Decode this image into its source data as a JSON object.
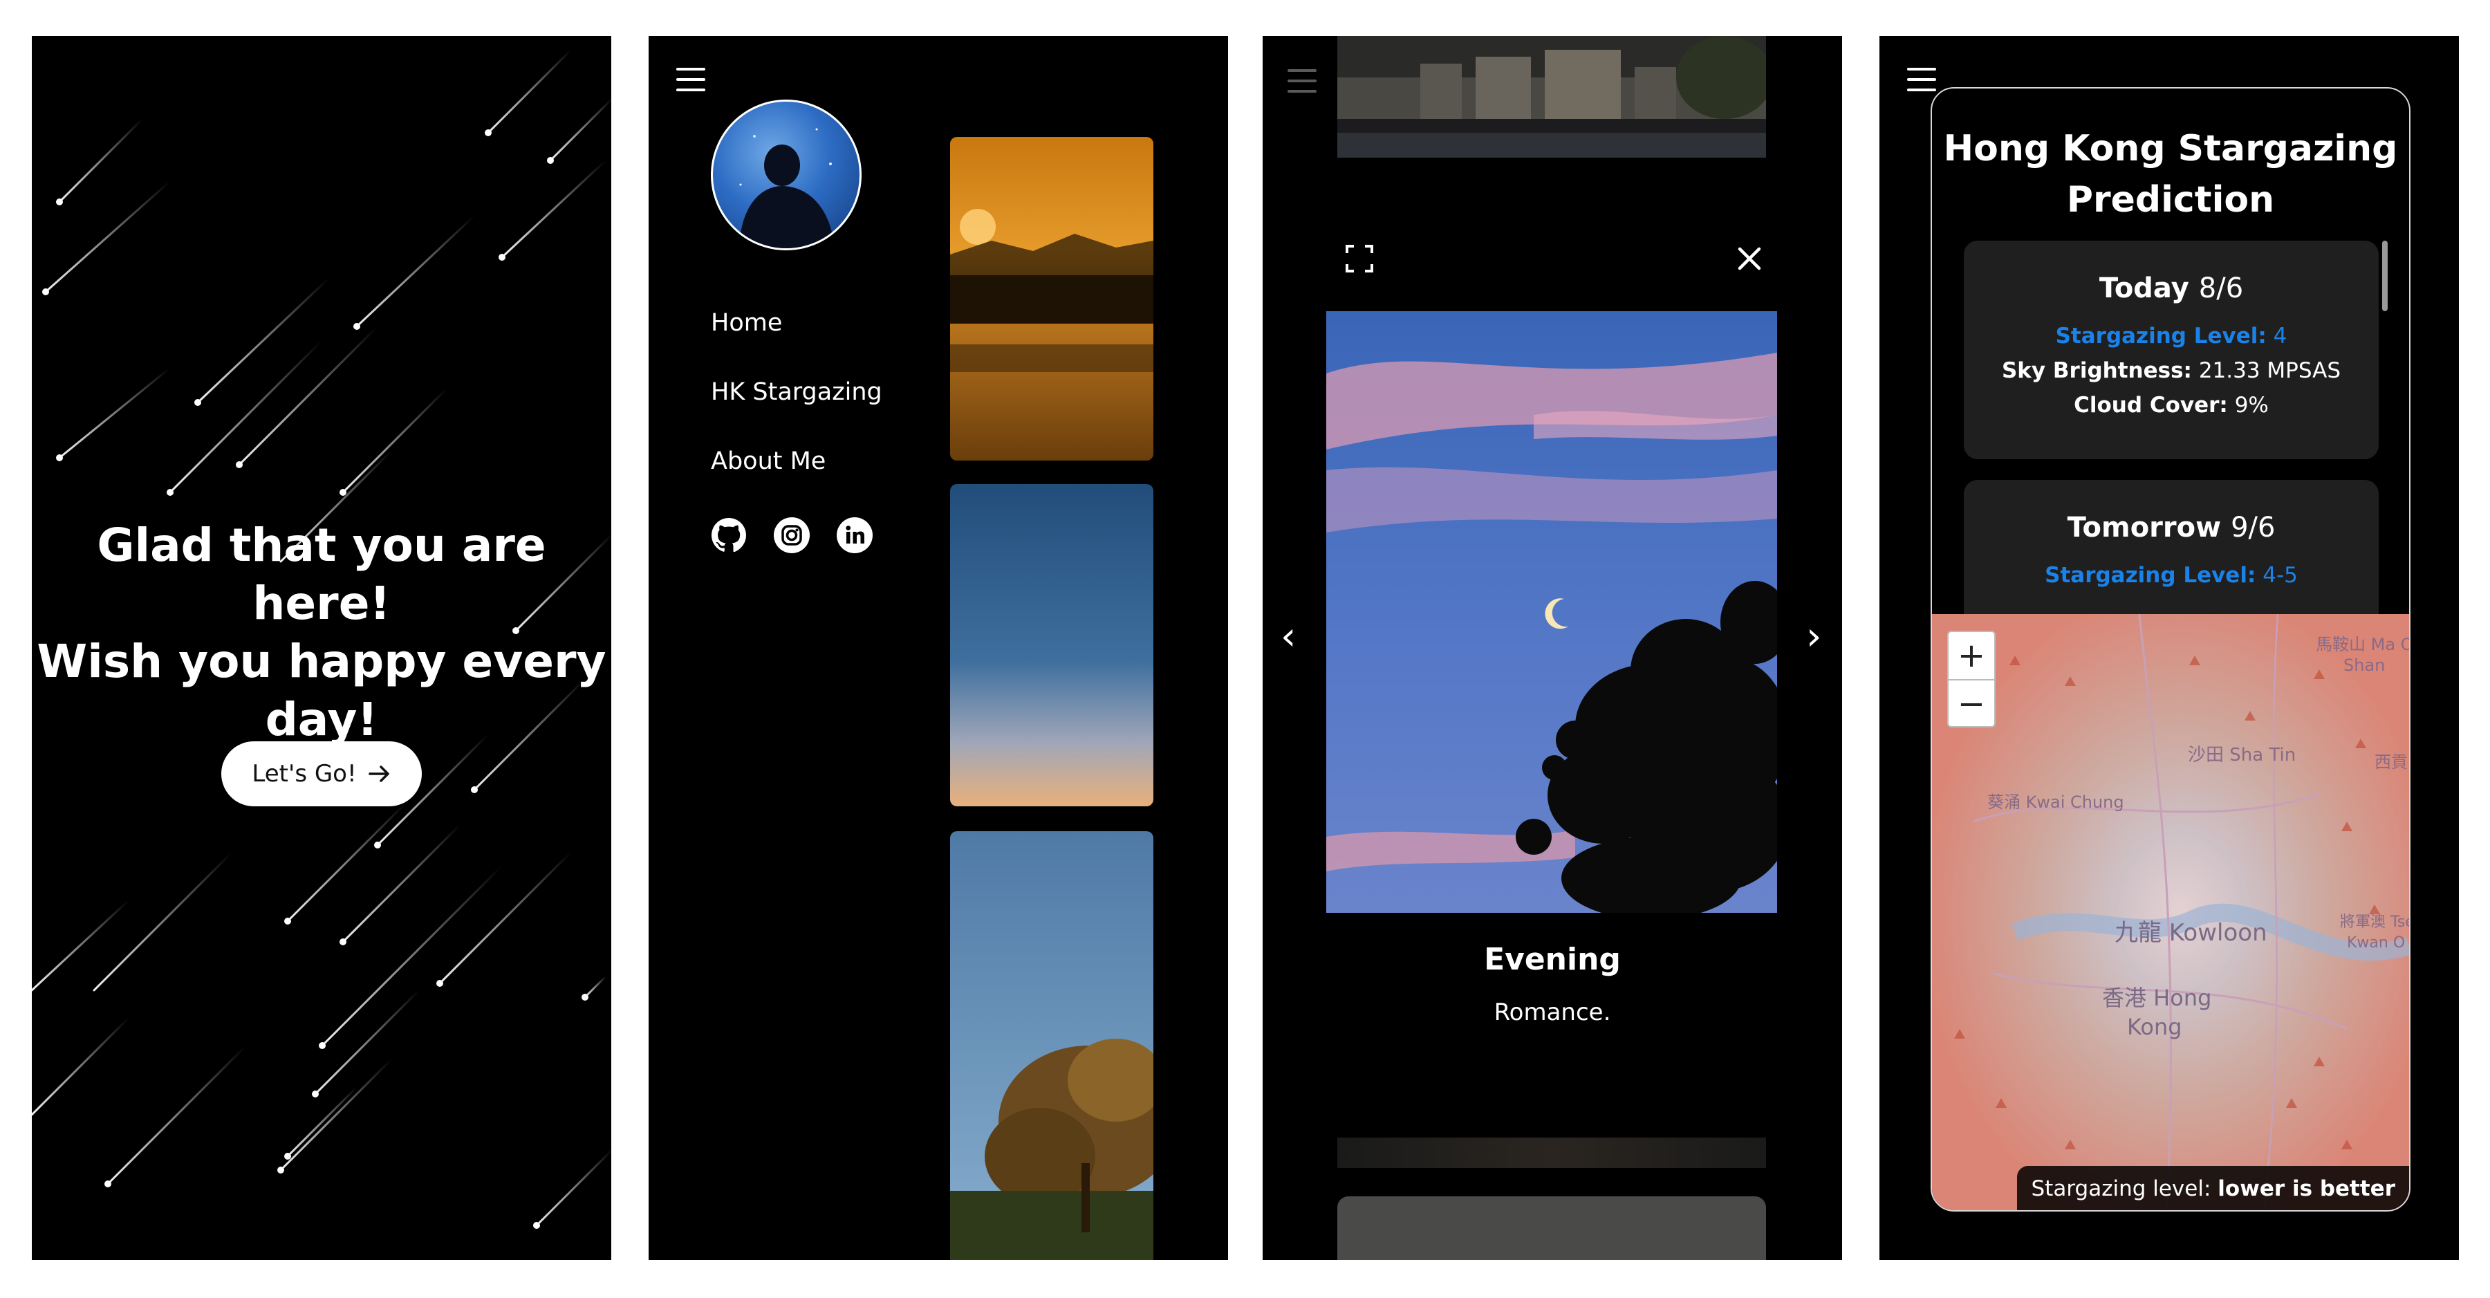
{
  "panel1": {
    "headline": [
      "Glad that you are here!",
      "Wish you happy every",
      "day!"
    ],
    "cta_label": "Let's Go!"
  },
  "panel2": {
    "nav": [
      {
        "label": "Home"
      },
      {
        "label": "HK Stargazing"
      },
      {
        "label": "About Me"
      }
    ],
    "social": [
      "github-icon",
      "instagram-icon",
      "linkedin-icon"
    ]
  },
  "panel3": {
    "caption_title": "Evening",
    "caption_subtitle": "Romance."
  },
  "panel4": {
    "title": [
      "Hong Kong Stargazing",
      "Prediction"
    ],
    "forecast": [
      {
        "day": "Today",
        "date": "8/6",
        "level_label": "Stargazing Level:",
        "level_value": "4",
        "brightness_label": "Sky Brightness:",
        "brightness_value": "21.33 MPSAS",
        "cloud_label": "Cloud Cover:",
        "cloud_value": "9%"
      },
      {
        "day": "Tomorrow",
        "date": "9/6",
        "level_label": "Stargazing Level:",
        "level_value": "4-5"
      }
    ],
    "map": {
      "zoom_in": "+",
      "zoom_out": "−",
      "places": [
        "馬鞍山 Ma On",
        "Shan",
        "沙田 Sha Tin",
        "葵涌 Kwai Chung",
        "九龍 Kowloon",
        "香港 Hong",
        "Kong",
        "將軍澳 Tseu",
        "Kwan O",
        "西貢 Sa"
      ],
      "legend_prefix": "Stargazing level:",
      "legend_value": "lower is better"
    }
  }
}
